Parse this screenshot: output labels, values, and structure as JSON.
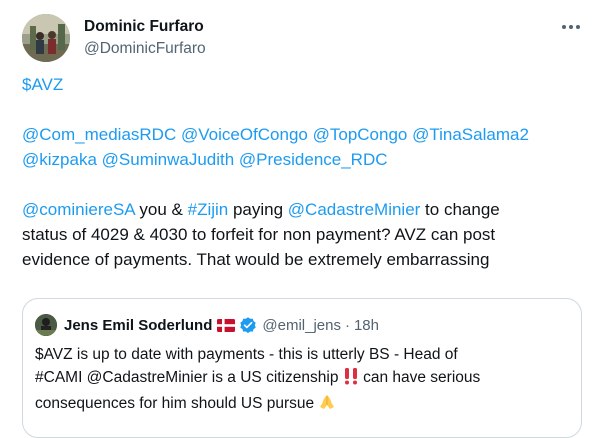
{
  "author": {
    "name": "Dominic Furfaro",
    "handle": "@DominicFurfaro"
  },
  "tweet": {
    "line1": [
      {
        "text": "$AVZ",
        "link": true
      }
    ],
    "line3": [
      {
        "text": "@Com_mediasRDC",
        "link": true
      },
      {
        "text": " ",
        "link": false
      },
      {
        "text": "@VoiceOfCongo",
        "link": true
      },
      {
        "text": " ",
        "link": false
      },
      {
        "text": "@TopCongo",
        "link": true
      },
      {
        "text": " ",
        "link": false
      },
      {
        "text": "@TinaSalama2",
        "link": true
      }
    ],
    "line4": [
      {
        "text": "@kizpaka",
        "link": true
      },
      {
        "text": " ",
        "link": false
      },
      {
        "text": "@SuminwaJudith",
        "link": true
      },
      {
        "text": " ",
        "link": false
      },
      {
        "text": "@Presidence_RDC",
        "link": true
      }
    ],
    "line6": [
      {
        "text": "@cominiereSA",
        "link": true
      },
      {
        "text": " you & ",
        "link": false
      },
      {
        "text": "#Zijin",
        "link": true
      },
      {
        "text": " paying ",
        "link": false
      },
      {
        "text": "@CadastreMinier",
        "link": true
      },
      {
        "text": " to change",
        "link": false
      }
    ],
    "line7": "status of 4029 & 4030 to forfeit for non payment? AVZ can post",
    "line8": "evidence of payments. That would be extremely embarrassing"
  },
  "quote": {
    "name": "Jens Emil Soderlund",
    "handle": "@emil_jens",
    "separator": "·",
    "time": "18h",
    "line1": "$AVZ is up to date with payments - this is utterly BS - Head of",
    "line2a": "#CAMI @CadastreMinier is a US citizenship ",
    "line2b": " can have serious",
    "line3": "consequences for him should US pursue ",
    "emoji_alarm": "‼️",
    "emoji_pray": "🙏"
  },
  "colors": {
    "link": "#1d9bf0",
    "text": "#0f1419",
    "muted": "#536471",
    "border": "#cfd9de",
    "verified": "#1d9bf0",
    "flag_red": "#c8102e"
  },
  "icons": {
    "more": "more-horizontal-icon",
    "verified": "verified-badge-icon",
    "flag": "denmark-flag-icon"
  }
}
